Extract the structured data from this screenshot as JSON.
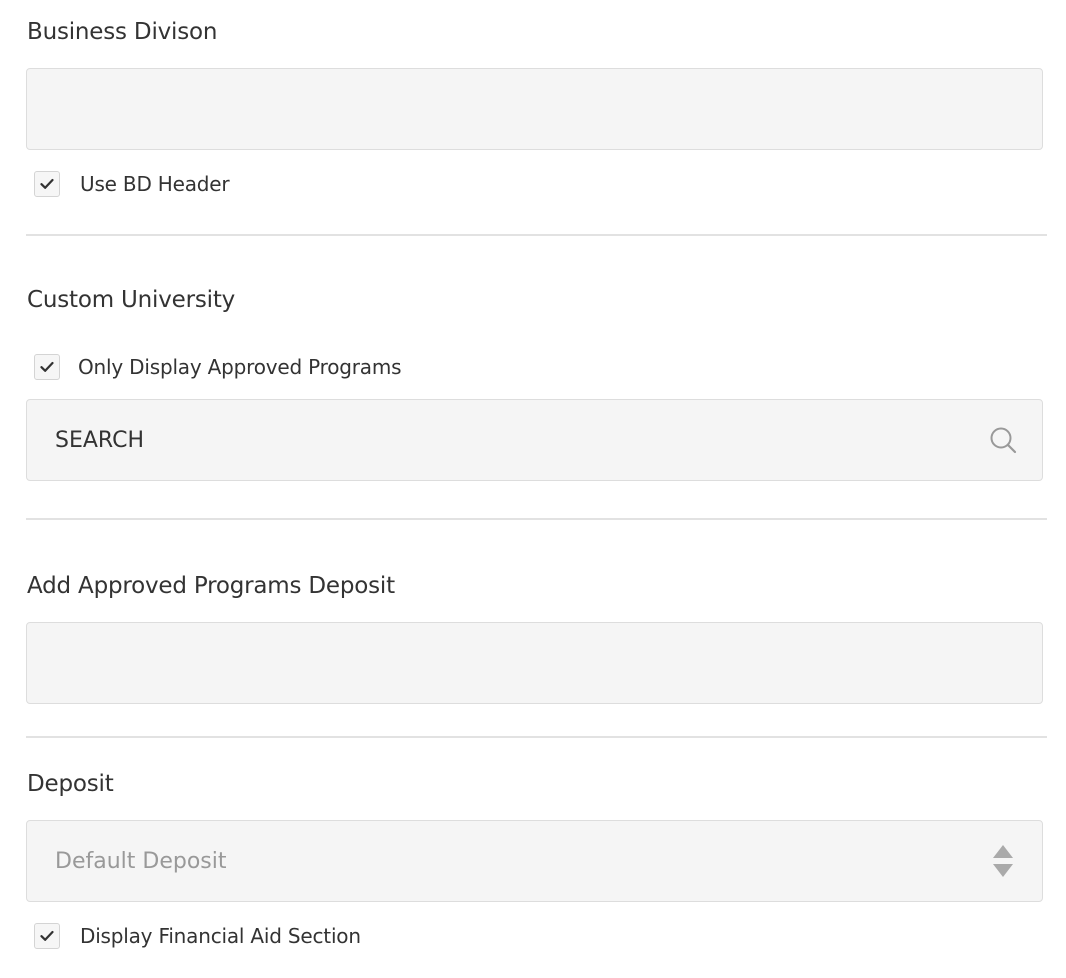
{
  "business_division": {
    "label": "Business Divison",
    "value": "",
    "use_bd_header": {
      "label": "Use BD Header",
      "checked": true
    }
  },
  "custom_university": {
    "label": "Custom University",
    "only_display_approved": {
      "label": "Only Display Approved Programs",
      "checked": true
    },
    "search": {
      "placeholder": "SEARCH",
      "value": "",
      "icon": "search-icon"
    }
  },
  "approved_programs_deposit": {
    "label": "Add Approved Programs Deposit",
    "value": ""
  },
  "deposit": {
    "label": "Deposit",
    "placeholder": "Default Deposit",
    "icon": "sort-arrows-icon",
    "display_financial_aid": {
      "label": "Display Financial Aid Section",
      "checked": true
    }
  },
  "colors": {
    "field_bg": "#f5f5f5",
    "field_border": "#dddddd",
    "divider": "#e2e2e2",
    "text": "#333333",
    "muted_text": "#999999",
    "icon": "#aaaaaa"
  }
}
